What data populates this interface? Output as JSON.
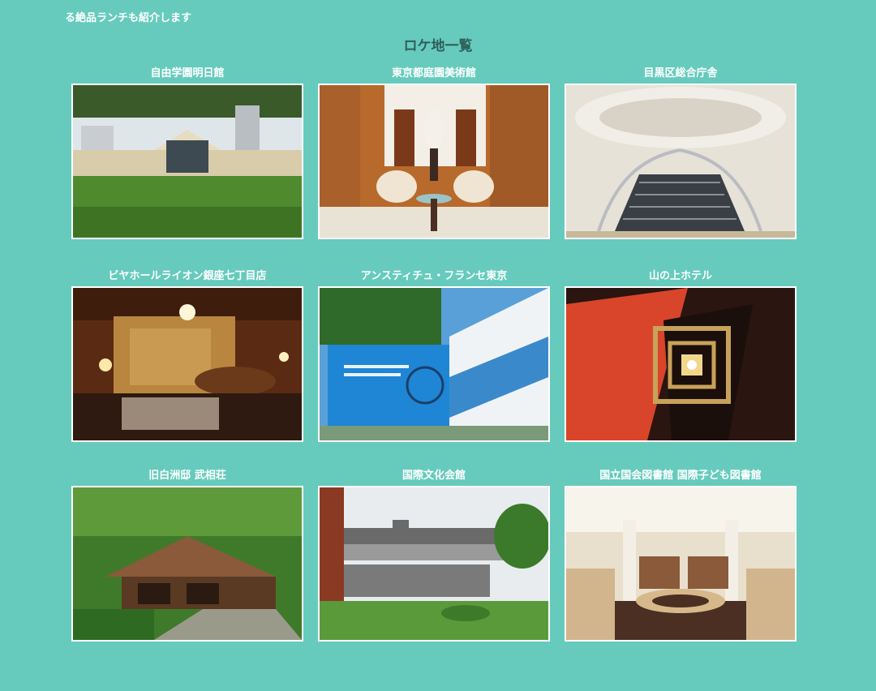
{
  "intro": {
    "text": "る絶品ランチも紹介します"
  },
  "section": {
    "title": "ロケ地一覧"
  },
  "locations": [
    {
      "name": "自由学園明日館"
    },
    {
      "name": "東京都庭園美術館"
    },
    {
      "name": "目黒区総合庁舎"
    },
    {
      "name": "ビヤホールライオン銀座七丁目店"
    },
    {
      "name": "アンスティチュ・フランセ東京"
    },
    {
      "name": "山の上ホテル"
    },
    {
      "name": "旧白洲邸 武相荘"
    },
    {
      "name": "国際文化会館"
    },
    {
      "name": "国立国会図書館 国際子ども図書館"
    }
  ],
  "colors": {
    "background": "#66cbbd",
    "title": "#2f5f5a",
    "caption": "#ffffff"
  }
}
